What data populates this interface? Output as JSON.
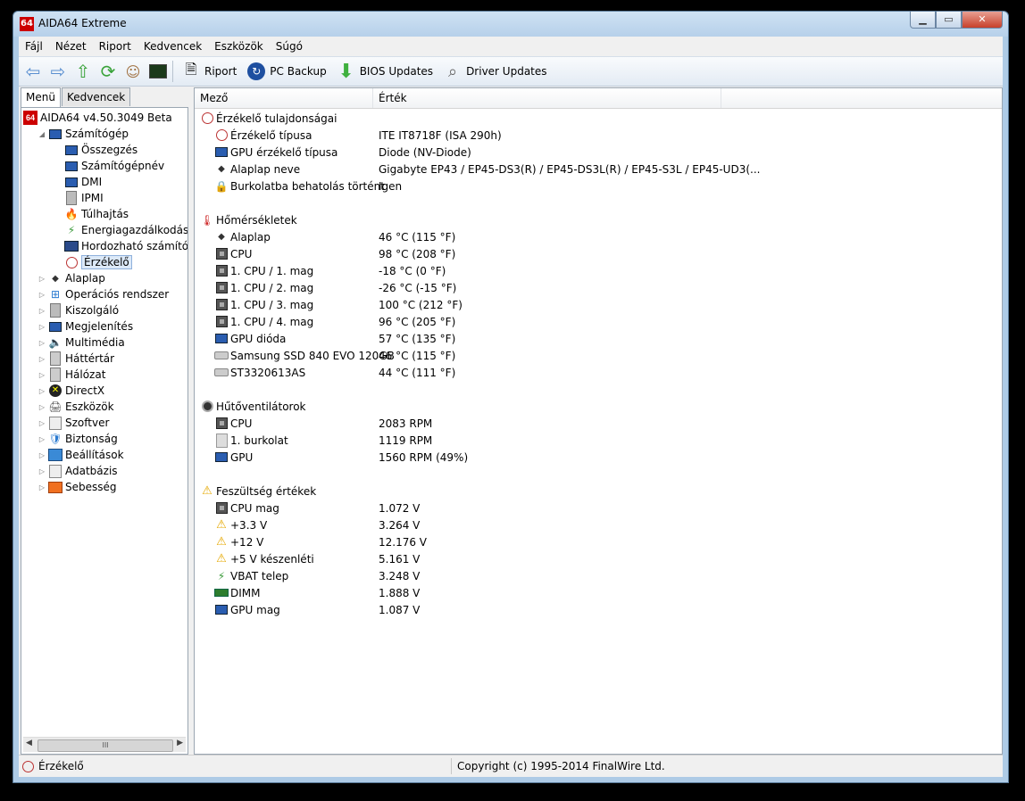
{
  "window": {
    "title": "AIDA64 Extreme",
    "app_icon": "64"
  },
  "menubar": [
    "Fájl",
    "Nézet",
    "Riport",
    "Kedvencek",
    "Eszközök",
    "Súgó"
  ],
  "toolbar": {
    "nav_icons": [
      "back-icon",
      "forward-icon",
      "up-icon",
      "refresh-icon",
      "user-icon",
      "monitor-icon"
    ],
    "buttons": [
      {
        "label": "Riport",
        "icon": "report-icon"
      },
      {
        "label": "PC Backup",
        "icon": "backup-icon"
      },
      {
        "label": "BIOS Updates",
        "icon": "download-icon"
      },
      {
        "label": "Driver Updates",
        "icon": "search-icon"
      }
    ]
  },
  "left_tabs": [
    "Menü",
    "Kedvencek"
  ],
  "tree": [
    {
      "label": "AIDA64 v4.50.3049 Beta",
      "level": 0,
      "expander": "",
      "icon": "aida-icon"
    },
    {
      "label": "Számítógép",
      "level": 1,
      "expander": "◢",
      "icon": "computer-icon"
    },
    {
      "label": "Összegzés",
      "level": 2,
      "expander": "",
      "icon": "computer-icon"
    },
    {
      "label": "Számítógépnév",
      "level": 2,
      "expander": "",
      "icon": "computer-icon"
    },
    {
      "label": "DMI",
      "level": 2,
      "expander": "",
      "icon": "computer-icon"
    },
    {
      "label": "IPMI",
      "level": 2,
      "expander": "",
      "icon": "server-icon"
    },
    {
      "label": "Túlhajtás",
      "level": 2,
      "expander": "",
      "icon": "fire-icon"
    },
    {
      "label": "Energiagazdálkodás",
      "level": 2,
      "expander": "",
      "icon": "power-icon"
    },
    {
      "label": "Hordozható számítógé",
      "level": 2,
      "expander": "",
      "icon": "laptop-icon"
    },
    {
      "label": "Érzékelő",
      "level": 2,
      "expander": "",
      "icon": "sensor-icon",
      "selected": true
    },
    {
      "label": "Alaplap",
      "level": 1,
      "expander": "▷",
      "icon": "motherboard-icon"
    },
    {
      "label": "Operációs rendszer",
      "level": 1,
      "expander": "▷",
      "icon": "windows-icon"
    },
    {
      "label": "Kiszolgáló",
      "level": 1,
      "expander": "▷",
      "icon": "server-icon"
    },
    {
      "label": "Megjelenítés",
      "level": 1,
      "expander": "▷",
      "icon": "monitor-icon"
    },
    {
      "label": "Multimédia",
      "level": 1,
      "expander": "▷",
      "icon": "speaker-icon"
    },
    {
      "label": "Háttértár",
      "level": 1,
      "expander": "▷",
      "icon": "storage-icon"
    },
    {
      "label": "Hálózat",
      "level": 1,
      "expander": "▷",
      "icon": "network-icon"
    },
    {
      "label": "DirectX",
      "level": 1,
      "expander": "▷",
      "icon": "directx-icon"
    },
    {
      "label": "Eszközök",
      "level": 1,
      "expander": "▷",
      "icon": "devices-icon"
    },
    {
      "label": "Szoftver",
      "level": 1,
      "expander": "▷",
      "icon": "software-icon"
    },
    {
      "label": "Biztonság",
      "level": 1,
      "expander": "▷",
      "icon": "shield-icon"
    },
    {
      "label": "Beállítások",
      "level": 1,
      "expander": "▷",
      "icon": "settings-icon"
    },
    {
      "label": "Adatbázis",
      "level": 1,
      "expander": "▷",
      "icon": "database-icon"
    },
    {
      "label": "Sebesség",
      "level": 1,
      "expander": "▷",
      "icon": "benchmark-icon"
    }
  ],
  "columns": [
    "Mező",
    "Érték"
  ],
  "rows": [
    {
      "type": "group",
      "field": "Érzékelő tulajdonságai",
      "icon": "sensor-icon"
    },
    {
      "type": "item",
      "field": "Érzékelő típusa",
      "value": "ITE IT8718F  (ISA 290h)",
      "icon": "sensor-icon"
    },
    {
      "type": "item",
      "field": "GPU érzékelő típusa",
      "value": "Diode  (NV-Diode)",
      "icon": "gpu-icon"
    },
    {
      "type": "item",
      "field": "Alaplap neve",
      "value": "Gigabyte EP43 / EP45-DS3(R) / EP45-DS3L(R) / EP45-S3L /  EP45-UD3(...",
      "icon": "motherboard-icon"
    },
    {
      "type": "item",
      "field": "Burkolatba behatolás történt",
      "value": "Igen",
      "icon": "lock-icon"
    },
    {
      "type": "blank"
    },
    {
      "type": "group",
      "field": "Hőmérsékletek",
      "icon": "thermometer-icon"
    },
    {
      "type": "item",
      "field": "Alaplap",
      "value": "46 °C  (115 °F)",
      "icon": "motherboard-icon"
    },
    {
      "type": "item",
      "field": "CPU",
      "value": "98 °C  (208 °F)",
      "icon": "cpu-icon"
    },
    {
      "type": "item",
      "field": "1. CPU / 1. mag",
      "value": "-18 °C  (0 °F)",
      "icon": "cpu-icon"
    },
    {
      "type": "item",
      "field": "1. CPU / 2. mag",
      "value": "-26 °C  (-15 °F)",
      "icon": "cpu-icon"
    },
    {
      "type": "item",
      "field": "1. CPU / 3. mag",
      "value": "100 °C  (212 °F)",
      "icon": "cpu-icon"
    },
    {
      "type": "item",
      "field": "1. CPU / 4. mag",
      "value": "96 °C  (205 °F)",
      "icon": "cpu-icon"
    },
    {
      "type": "item",
      "field": "GPU dióda",
      "value": "57 °C  (135 °F)",
      "icon": "gpu-icon"
    },
    {
      "type": "item",
      "field": "Samsung SSD 840 EVO 120GB",
      "value": "46 °C  (115 °F)",
      "icon": "drive-icon"
    },
    {
      "type": "item",
      "field": "ST3320613AS",
      "value": "44 °C  (111 °F)",
      "icon": "drive-icon"
    },
    {
      "type": "blank"
    },
    {
      "type": "group",
      "field": "Hűtőventilátorok",
      "icon": "fan-icon"
    },
    {
      "type": "item",
      "field": "CPU",
      "value": "2083 RPM",
      "icon": "cpu-icon"
    },
    {
      "type": "item",
      "field": "1. burkolat",
      "value": "1119 RPM",
      "icon": "case-icon"
    },
    {
      "type": "item",
      "field": "GPU",
      "value": "1560 RPM  (49%)",
      "icon": "gpu-icon"
    },
    {
      "type": "blank"
    },
    {
      "type": "group",
      "field": "Feszültség értékek",
      "icon": "warning-icon"
    },
    {
      "type": "item",
      "field": "CPU mag",
      "value": "1.072 V",
      "icon": "cpu-icon"
    },
    {
      "type": "item",
      "field": "+3.3 V",
      "value": "3.264 V",
      "icon": "warning-icon"
    },
    {
      "type": "item",
      "field": "+12 V",
      "value": "12.176 V",
      "icon": "warning-icon"
    },
    {
      "type": "item",
      "field": "+5 V készenléti",
      "value": "5.161 V",
      "icon": "warning-icon"
    },
    {
      "type": "item",
      "field": "VBAT telep",
      "value": "3.248 V",
      "icon": "battery-icon"
    },
    {
      "type": "item",
      "field": "DIMM",
      "value": "1.888 V",
      "icon": "memory-icon"
    },
    {
      "type": "item",
      "field": "GPU mag",
      "value": "1.087 V",
      "icon": "gpu-icon"
    }
  ],
  "statusbar": {
    "left": "Érzékelő",
    "right": "Copyright (c) 1995-2014 FinalWire Ltd."
  }
}
